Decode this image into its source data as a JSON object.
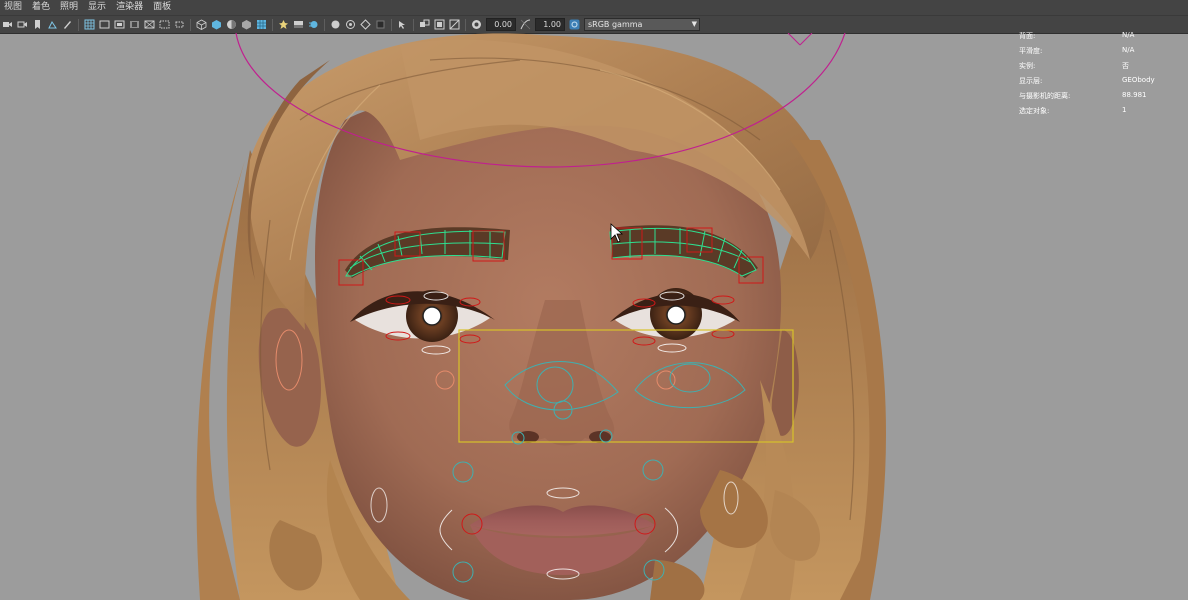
{
  "menu": [
    "视图",
    "着色",
    "照明",
    "显示",
    "渲染器",
    "面板"
  ],
  "toolbar": {
    "icons": [
      "camera-select-icon",
      "camera-attributes-icon",
      "bookmark-icon",
      "image-plane-icon",
      "grease-pencil-icon",
      "grid-icon",
      "film-gate-icon",
      "resolution-gate-icon",
      "gate-mask-icon",
      "field-chart-icon",
      "safe-action-icon",
      "safe-title-icon",
      "wireframe-icon",
      "smooth-shade-icon",
      "wireframe-on-shaded-icon",
      "textured-icon",
      "lighting-icon",
      "shadows-icon",
      "screen-space-ao-icon",
      "motion-blur-icon",
      "xray-icon",
      "xray-joints-icon",
      "backface-icon",
      "isolate-select-icon",
      "xray-components-icon",
      "camera-lock-icon",
      "exposure-icon",
      "gamma-icon"
    ],
    "exposure": "0.00",
    "gamma": "1.00",
    "color_space": "sRGB gamma"
  },
  "hud": [
    {
      "label": "背面:",
      "value": "N/A"
    },
    {
      "label": "平滑度:",
      "value": "N/A"
    },
    {
      "label": "实例:",
      "value": "否"
    },
    {
      "label": "显示层:",
      "value": "GEObody"
    },
    {
      "label": "与摄影机的距离:",
      "value": "88.981"
    },
    {
      "label": "选定对象:",
      "value": "1"
    }
  ],
  "colors": {
    "ui_dark": "#444444",
    "viewport_bg": "#9c9c9c",
    "skin": "#a36e58",
    "hair": "#b8875a",
    "head_ctrl": "#c0208f",
    "brow_ctrl": "#2ee090",
    "face_ctrl": "#d01818",
    "nose_box": "#d7c12a",
    "nose_ctrl": "#3fb0b0"
  }
}
